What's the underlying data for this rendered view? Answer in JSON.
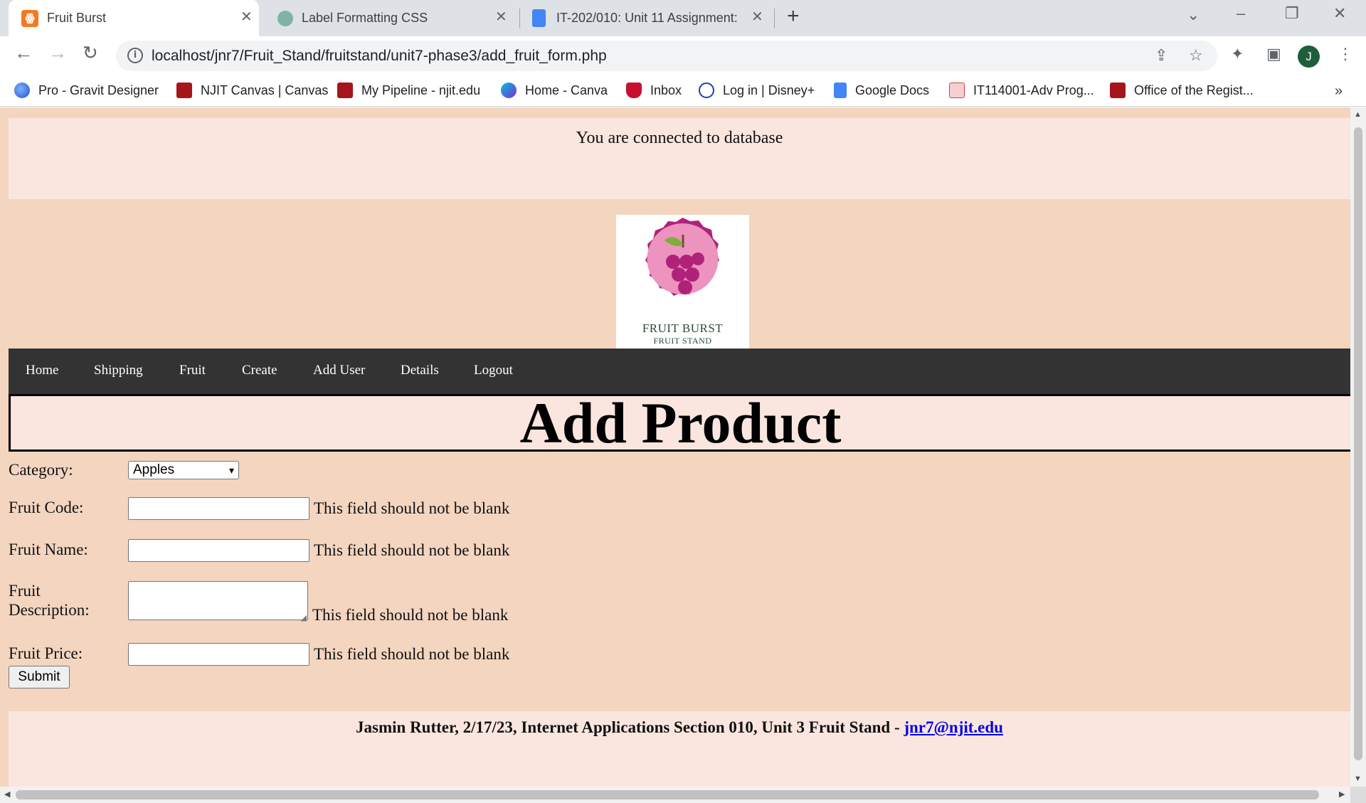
{
  "browser": {
    "tabs": [
      {
        "title": "Fruit Burst",
        "close": "✕"
      },
      {
        "title": "Label Formatting CSS",
        "close": "✕"
      },
      {
        "title": "IT-202/010: Unit 11 Assignment:",
        "close": "✕"
      }
    ],
    "new_tab": "+",
    "address": "localhost/jnr7/Fruit_Stand/fruitstand/unit7-phase3/add_fruit_form.php",
    "profile_initial": "J",
    "bookmarks": [
      "Pro - Gravit Designer",
      "NJIT Canvas | Canvas",
      "My Pipeline - njit.edu",
      "Home - Canva",
      "Inbox",
      "Log in | Disney+",
      "Google Docs",
      "IT114001-Adv Prog...",
      "Office of the Regist..."
    ],
    "bookmarks_more": "»"
  },
  "page": {
    "db_status": "You are connected to database",
    "logo": {
      "line1": "FRUIT BURST",
      "line2": "FRUIT STAND"
    },
    "nav": [
      "Home",
      "Shipping",
      "Fruit",
      "Create",
      "Add User",
      "Details",
      "Logout"
    ],
    "title": "Add Product",
    "form": {
      "category_label": "Category:",
      "category_value": "Apples",
      "code_label": "Fruit Code:",
      "name_label": "Fruit Name:",
      "desc_label_1": "Fruit",
      "desc_label_2": "Description:",
      "price_label": "Fruit Price:",
      "error_text": "This field should not be blank",
      "submit_label": "Submit"
    },
    "footer": {
      "text": "Jasmin Rutter, 2/17/23, Internet Applications Section 010, Unit 3 Fruit Stand - ",
      "email": "jnr7@njit.edu"
    }
  },
  "colors": {
    "page_bg": "#f3d5c0",
    "panel_bg": "#fae6df",
    "navbar_bg": "#333333",
    "logo_pink": "#ec93bf",
    "logo_magenta": "#b0227a",
    "link": "#0000ee"
  }
}
